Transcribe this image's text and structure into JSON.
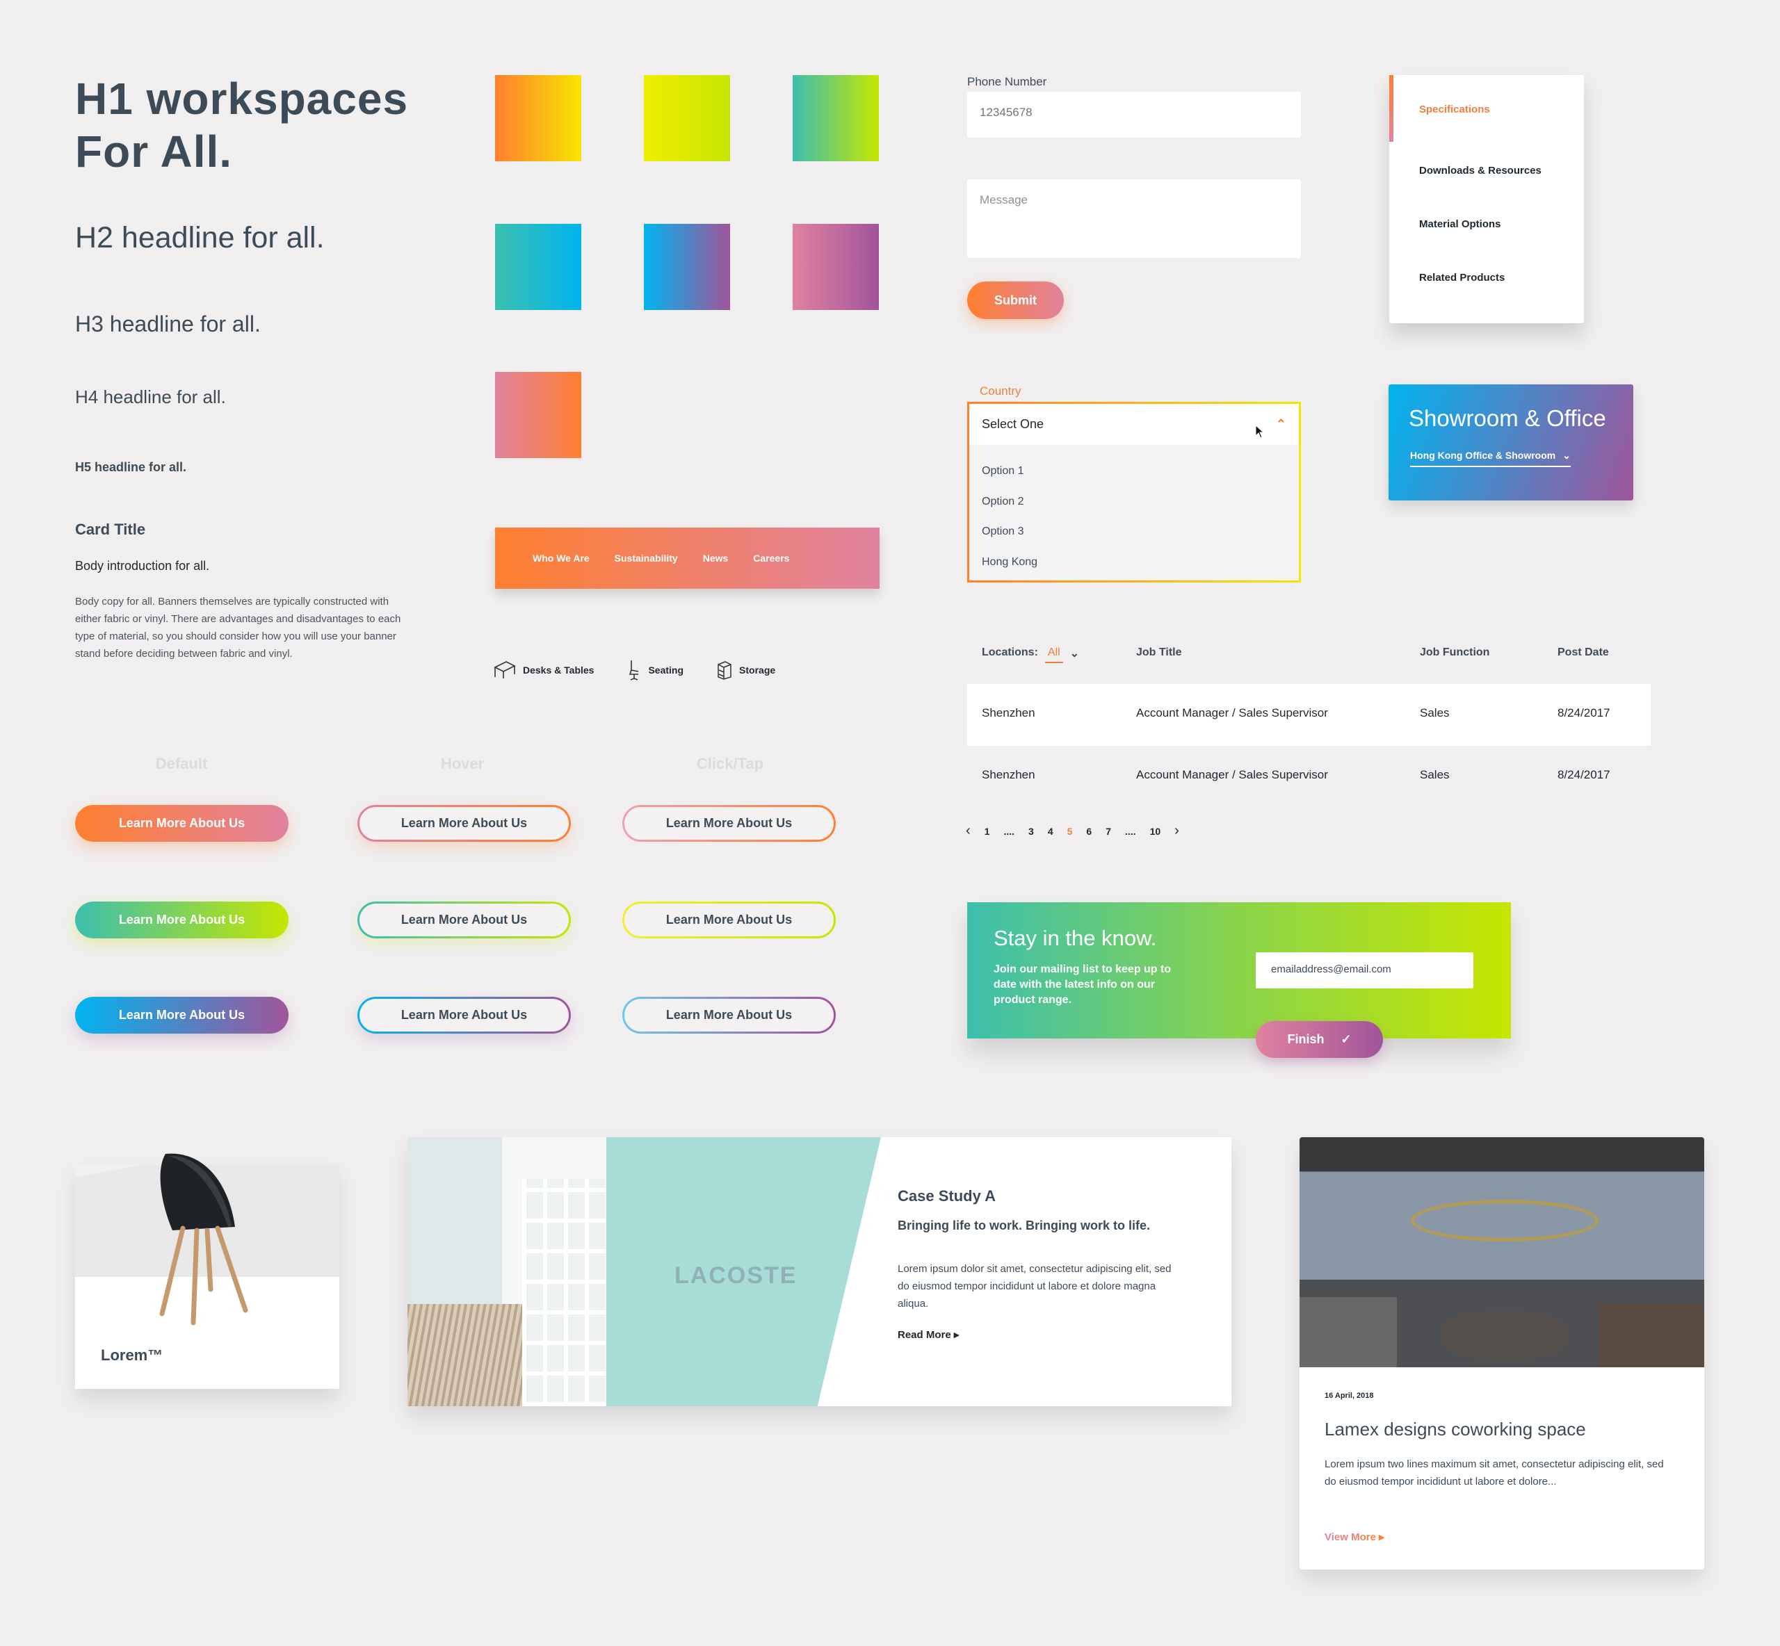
{
  "typography": {
    "h1_line1": "H1 workspaces",
    "h1_line2": "For All.",
    "h2": "H2 headline for all.",
    "h3": "H3 headline for all.",
    "h4": "H4 headline for all.",
    "h5": "H5 headline for all.",
    "card_title": "Card Title",
    "body_intro": "Body introduction for all.",
    "body_copy": "Body copy for all. Banners themselves are typically constructed with either fabric or vinyl. There are advantages and disadvantages to each type of material, so you should consider how you will use your banner stand before deciding between fabric and vinyl."
  },
  "colors": {
    "orange": "#ff7f2f",
    "yellow": "#eeee00",
    "lime": "#c6e600",
    "teal": "#3cbfae",
    "cyan": "#00b4ef",
    "purple": "#a0559a",
    "pink": "#e0829f",
    "text": "#3d4b58",
    "background": "#f0eeef"
  },
  "nav": {
    "items": [
      "Who We Are",
      "Sustainability",
      "News",
      "Careers"
    ]
  },
  "categories": [
    {
      "label": "Desks & Tables",
      "icon": "desk-icon"
    },
    {
      "label": "Seating",
      "icon": "chair-icon"
    },
    {
      "label": "Storage",
      "icon": "cabinet-icon"
    }
  ],
  "button_states": {
    "default": "Default",
    "hover": "Hover",
    "click": "Click/Tap",
    "label": "Learn More About Us"
  },
  "form": {
    "phone_label": "Phone Number",
    "phone_value": "12345678",
    "message_placeholder": "Message",
    "submit": "Submit",
    "country_label": "Country",
    "select_value": "Select One",
    "options": [
      "Option 1",
      "Option 2",
      "Option 3",
      "Hong Kong"
    ]
  },
  "tabs": {
    "items": [
      "Specifications",
      "Downloads & Resources",
      "Material Options",
      "Related Products"
    ],
    "active": 0
  },
  "showroom": {
    "title": "Showroom & Office",
    "selector": "Hong Kong Office & Showroom"
  },
  "jobs": {
    "locations_label": "Locations:",
    "locations_value": "All",
    "headers": [
      "Job Title",
      "Job Function",
      "Post Date"
    ],
    "rows": [
      [
        "Shenzhen",
        "Account Manager / Sales Supervisor",
        "Sales",
        "8/24/2017"
      ],
      [
        "Shenzhen",
        "Account Manager / Sales Supervisor",
        "Sales",
        "8/24/2017"
      ]
    ]
  },
  "pagination": {
    "pages": [
      "1",
      "....",
      "3",
      "4",
      "5",
      "6",
      "7",
      "....",
      "10"
    ],
    "current": "5"
  },
  "newsletter": {
    "title": "Stay in the know.",
    "text": "Join our mailing list to keep up to date with the latest info on our product range.",
    "email_value": "emailaddress@email.com",
    "finish": "Finish"
  },
  "product": {
    "name": "Lorem™"
  },
  "case_study": {
    "title": "Case Study A",
    "tagline": "Bringing life to work. Bringing work to life.",
    "body": "Lorem ipsum dolor sit amet, consectetur adipiscing elit, sed do eiusmod tempor incididunt ut labore et dolore magna aliqua.",
    "link": "Read More",
    "logo_text": "LACOSTE"
  },
  "article": {
    "date": "16 April, 2018",
    "title": "Lamex designs coworking space",
    "body": "Lorem ipsum two lines maximum sit amet, consectetur adipiscing elit, sed do eiusmod tempor incididunt ut labore et dolore...",
    "link": "View More"
  }
}
